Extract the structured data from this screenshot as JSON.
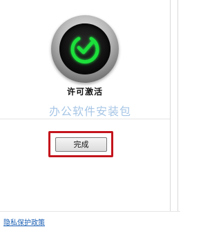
{
  "status": {
    "title": "许可激活",
    "state_icon": "check-power-icon",
    "accent_color": "#1fe03a"
  },
  "watermark": {
    "text": "办公软件安装包"
  },
  "actions": {
    "finish_label": "完成",
    "highlight_color": "#c4141c"
  },
  "footer": {
    "privacy_link": "隐私保护政策"
  }
}
